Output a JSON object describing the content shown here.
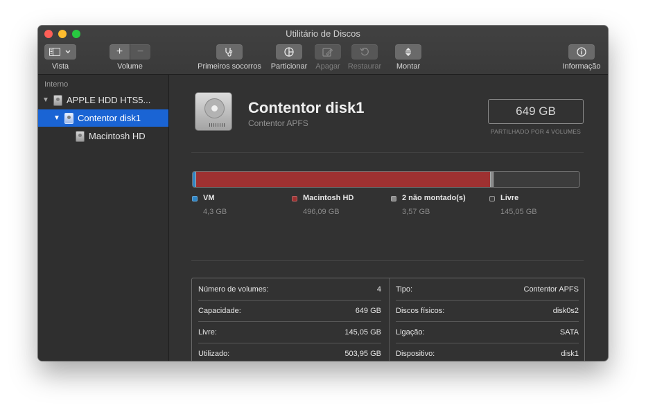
{
  "window": {
    "title": "Utilitário de Discos"
  },
  "toolbar": {
    "vista_label": "Vista",
    "volume_label": "Volume",
    "volume_add_symbol": "+",
    "volume_remove_symbol": "−",
    "first_aid_label": "Primeiros socorros",
    "partition_label": "Particionar",
    "erase_label": "Apagar",
    "restore_label": "Restaurar",
    "mount_label": "Montar",
    "info_label": "Informação"
  },
  "sidebar": {
    "section_title": "Interno",
    "items": [
      {
        "label": "APPLE HDD HTS5...",
        "level": 0,
        "expanded": true,
        "selected": false
      },
      {
        "label": "Contentor disk1",
        "level": 1,
        "expanded": true,
        "selected": true
      },
      {
        "label": "Macintosh HD",
        "level": 2,
        "expanded": false,
        "selected": false
      }
    ]
  },
  "detail": {
    "name": "Contentor disk1",
    "subtitle": "Contentor APFS",
    "size": "649 GB",
    "size_note": "PARTILHADO POR 4 VOLUMES"
  },
  "usage": {
    "segments": [
      {
        "name": "VM",
        "size": "4,3 GB",
        "color": "#2f86c6",
        "fraction": 0.0066
      },
      {
        "name": "Macintosh HD",
        "size": "496,09 GB",
        "color": "#9e3131",
        "fraction": 0.7644
      },
      {
        "name": "2 não montado(s)",
        "size": "3,57 GB",
        "color": "#8a8a8a",
        "fraction": 0.0055
      },
      {
        "name": "Livre",
        "size": "145,05 GB",
        "color": "#3c3c3c",
        "fraction": 0.2235
      }
    ]
  },
  "info": {
    "left": [
      {
        "label": "Número de volumes:",
        "value": "4"
      },
      {
        "label": "Capacidade:",
        "value": "649 GB"
      },
      {
        "label": "Livre:",
        "value": "145,05 GB"
      },
      {
        "label": "Utilizado:",
        "value": "503,95 GB"
      }
    ],
    "right": [
      {
        "label": "Tipo:",
        "value": "Contentor APFS"
      },
      {
        "label": "Discos físicos:",
        "value": "disk0s2"
      },
      {
        "label": "Ligação:",
        "value": "SATA"
      },
      {
        "label": "Dispositivo:",
        "value": "disk1"
      }
    ]
  }
}
